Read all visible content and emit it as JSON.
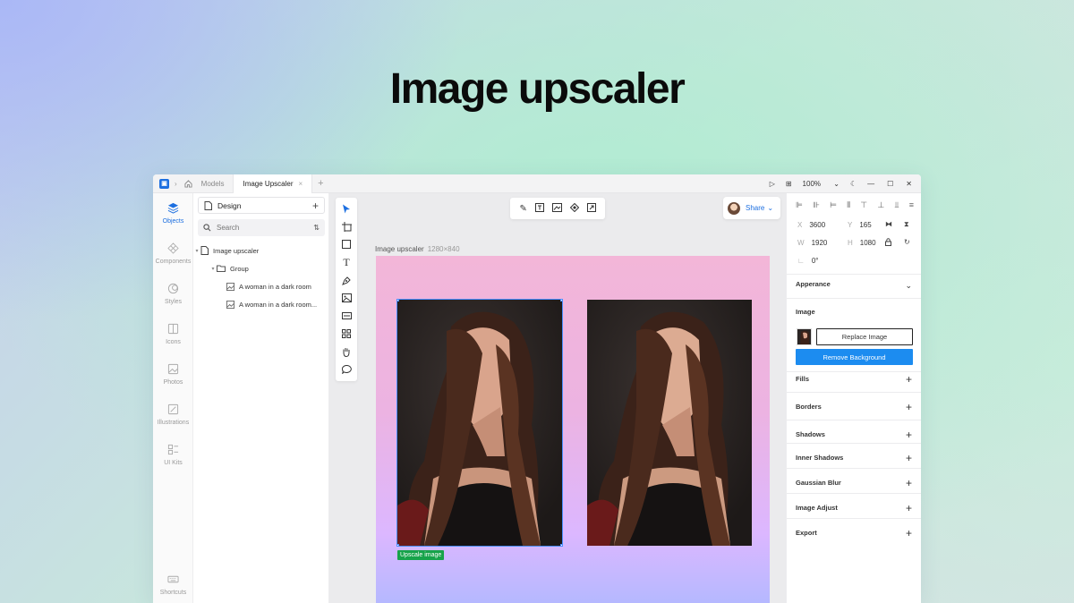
{
  "hero": {
    "title": "Image upscaler"
  },
  "titlebar": {
    "tabs": [
      {
        "label": "Models",
        "active": false
      },
      {
        "label": "Image Upscaler",
        "active": true
      }
    ],
    "zoom": "100%"
  },
  "leftnav": {
    "items": [
      {
        "label": "Objects",
        "icon": "layers-icon",
        "active": true
      },
      {
        "label": "Components",
        "icon": "components-icon"
      },
      {
        "label": "Styles",
        "icon": "styles-icon"
      },
      {
        "label": "Icons",
        "icon": "icons-icon"
      },
      {
        "label": "Photos",
        "icon": "photos-icon"
      },
      {
        "label": "Illustrations",
        "icon": "illustrations-icon"
      },
      {
        "label": "UI Kits",
        "icon": "ui-kits-icon"
      },
      {
        "label": "Shortcuts",
        "icon": "keyboard-icon"
      }
    ]
  },
  "layers": {
    "page_select": "Design",
    "search_placeholder": "Search",
    "tree": [
      {
        "label": "Image upscaler",
        "level": 0
      },
      {
        "label": "Group",
        "level": 1
      },
      {
        "label": "A woman in a dark room",
        "level": 2
      },
      {
        "label": "A woman in a dark room...",
        "level": 2
      }
    ]
  },
  "canvas": {
    "share_label": "Share",
    "frame_name": "Image upscaler",
    "frame_size": "1280×840",
    "upscale_label": "Upscale image"
  },
  "properties": {
    "x_label": "X",
    "x": "3600",
    "y_label": "Y",
    "y": "165",
    "w_label": "W",
    "w": "1920",
    "h_label": "H",
    "h": "1080",
    "rotation": "0°",
    "appearance": "Apperance",
    "image_section": "Image",
    "replace_image": "Replace Image",
    "remove_background": "Remove Background",
    "sections": [
      "Fills",
      "Borders",
      "Shadows",
      "Inner Shadows",
      "Gaussian Blur",
      "Image Adjust",
      "Export"
    ]
  },
  "colors": {
    "accent": "#1d6fe0",
    "remove_button": "#1c8cf0",
    "upscale_tag": "#17a34a"
  }
}
